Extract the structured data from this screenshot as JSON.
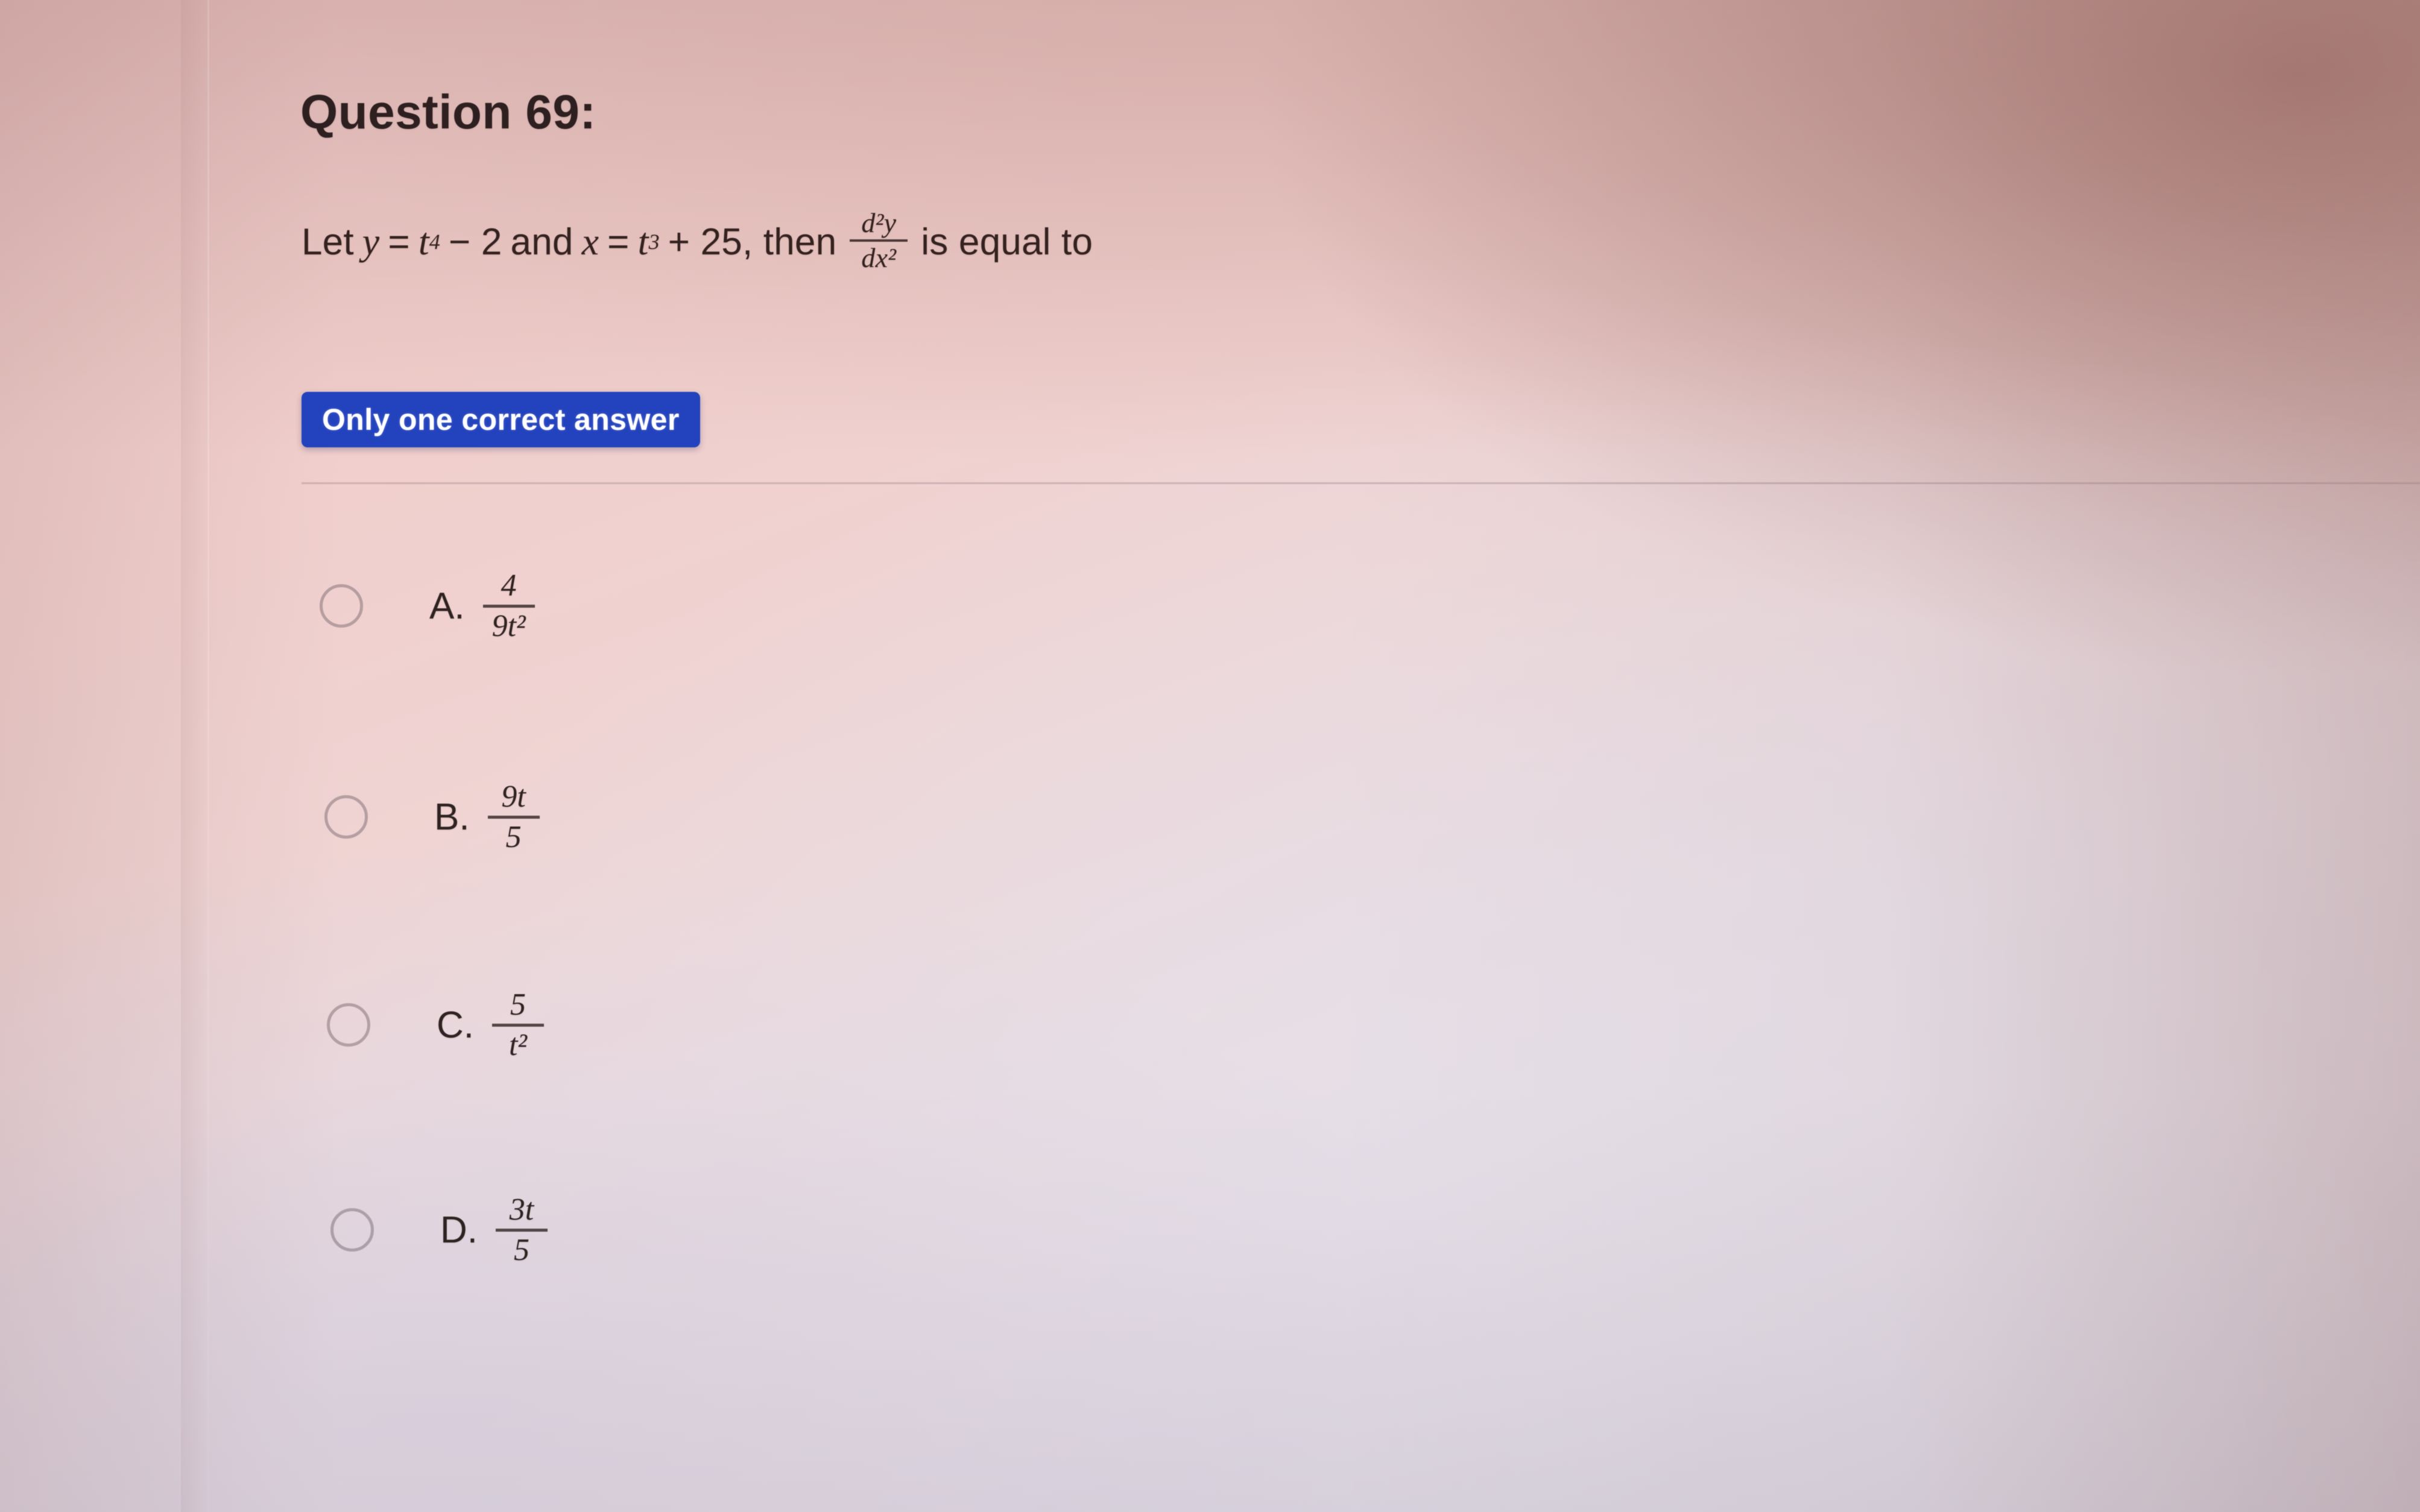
{
  "question": {
    "title": "Question 69:",
    "stem": {
      "lead": "Let",
      "y_var": "y",
      "eq1": "=",
      "y_base": "t",
      "y_exp": "4",
      "minus": "− 2",
      "and": "and",
      "x_var": "x",
      "eq2": "=",
      "x_base": "t",
      "x_exp": "3",
      "plus": "+ 25, then",
      "derivative_numerator": "d²y",
      "derivative_denominator": "dx²",
      "tail": "is equal to",
      "full_text": "Let y = t⁴ − 2 and x = t³ + 25, then d²y/dx² is equal to"
    },
    "badge_label": "Only one correct answer",
    "badge_color": "#2342bd",
    "badge_text_color": "#ffffff"
  },
  "options": [
    {
      "letter": "A.",
      "numerator": "4",
      "denominator": "9t²",
      "text": "4 / 9t²",
      "selected": false
    },
    {
      "letter": "B.",
      "numerator": "9t",
      "denominator": "5",
      "text": "9t / 5",
      "selected": false
    },
    {
      "letter": "C.",
      "numerator": "5",
      "denominator": "t²",
      "text": "5 / t²",
      "selected": false
    },
    {
      "letter": "D.",
      "numerator": "3t",
      "denominator": "5",
      "text": "3t / 5",
      "selected": false
    }
  ],
  "colors": {
    "text": "#2f2322",
    "title": "#2e2020",
    "accent_blue": "#2342bd",
    "radio_outline": "#6e5f69",
    "divider": "#5a4650"
  }
}
